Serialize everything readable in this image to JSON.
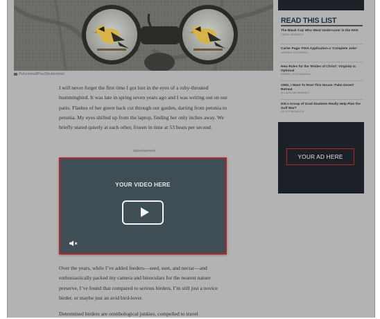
{
  "hero": {
    "caption": "Pictureimail/Pixs/Shutterstock"
  },
  "article": {
    "paragraph_1": "I will never forget the first time I got lost in the eyes of a ruby-throated hummingbird. It was late in spring seven years ago and I was writing out on our patio. Flashes of her green back cut through our garden, darting from petunia to petunia. My eyes shifted up from the laptop, finding her only inches away. We briefly stared quietly at each other, frozen in time at 53 beats per second.",
    "paragraph_2": "Over the years, while I’ve added feeders—seed, suet, and nectar—and enthusiastically packed my camera and binoculars for the nearest nature preserve, I’ve found that compared to serious birders, I’m still just a novice birder, or maybe just an avid bird-lover.",
    "paragraph_3": "Determined birders are ornithological junkies, compelled to travel"
  },
  "video_ad": {
    "label": "Advertisement",
    "title": "YOUR VIDEO HERE"
  },
  "sidebar": {
    "read_this_list": "READ THIS LIST",
    "items": [
      {
        "title": "The Black Cop Who Went Undercover in the KKK",
        "byline": "CAROL MORACEY"
      },
      {
        "title": "Carter Page: FISA Application a ‘Complete Joke’",
        "byline": "ANDREW DESIDERIO"
      },
      {
        "title": "New Rules for the ‘Brides of Christ’: Virginity Is Optional",
        "byline": "BARBIE LATZA NADEAU"
      },
      {
        "title": "OMG, I Want To Rent This House: Palm Desert Retreat",
        "byline": "ALLISON MCNEARNEY"
      },
      {
        "title": "Did a Group of Grad Students Really Help Plan the Gulf War?",
        "byline": "GEOFF MANAUGH"
      }
    ],
    "ad_label": "YOUR AD HERE"
  }
}
